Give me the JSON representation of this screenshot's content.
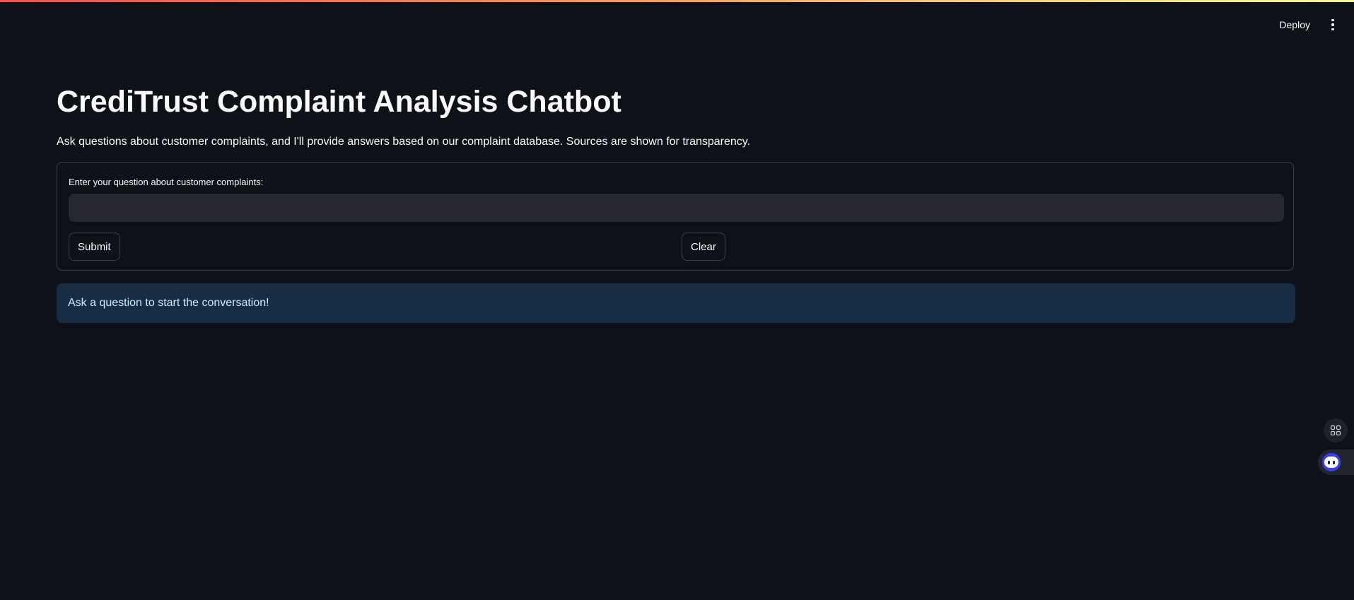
{
  "header": {
    "deploy_label": "Deploy",
    "menu_icon": "three-dots-vertical-icon"
  },
  "main": {
    "title": "CrediTrust Complaint Analysis Chatbot",
    "description": "Ask questions about customer complaints, and I'll provide answers based on our complaint database. Sources are shown for transparency.",
    "form": {
      "input_label": "Enter your question about customer complaints:",
      "input_value": "",
      "input_placeholder": "",
      "submit_label": "Submit",
      "clear_label": "Clear"
    },
    "info_message": "Ask a question to start the conversation!"
  },
  "floating": {
    "apps_icon": "grid-apps-icon",
    "assistant_icon": "assistant-bot-icon"
  },
  "colors": {
    "background": "#0e1117",
    "input_background": "#262730",
    "info_background": "#172d43",
    "info_text": "#c7ebff",
    "accent_gradient_start": "#ff4b4b",
    "accent_gradient_end": "#fffd80"
  }
}
